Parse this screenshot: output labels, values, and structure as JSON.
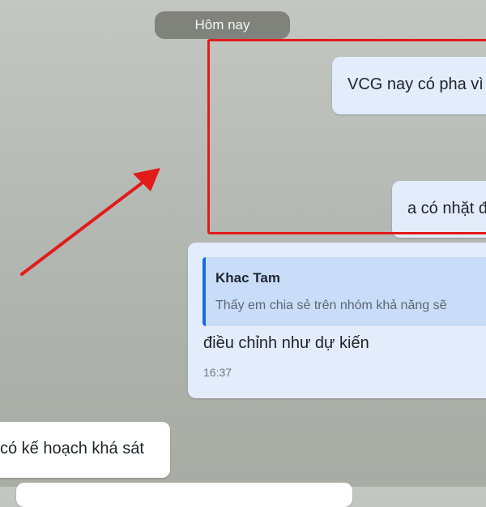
{
  "chat": {
    "date_separator": "Hôm nay",
    "messages": [
      {
        "text": "VCG nay có pha vì"
      },
      {
        "text": "a có nhặt đ"
      },
      {
        "reply_author": "Khac Tam",
        "reply_text": "Thấy em chia sẻ trên nhóm khả năng sẽ",
        "text": "điều chỉnh như dự kiến",
        "time": "16:37"
      },
      {
        "text": "có kế hoạch khá sát"
      }
    ]
  },
  "annotation": {
    "color": "#e21b1b",
    "shapes": [
      "rectangle-highlight",
      "arrow"
    ]
  },
  "colors": {
    "own_bubble": "#e3ecfb",
    "other_bubble": "#ffffff",
    "quote_accent": "#1a6ae0"
  }
}
